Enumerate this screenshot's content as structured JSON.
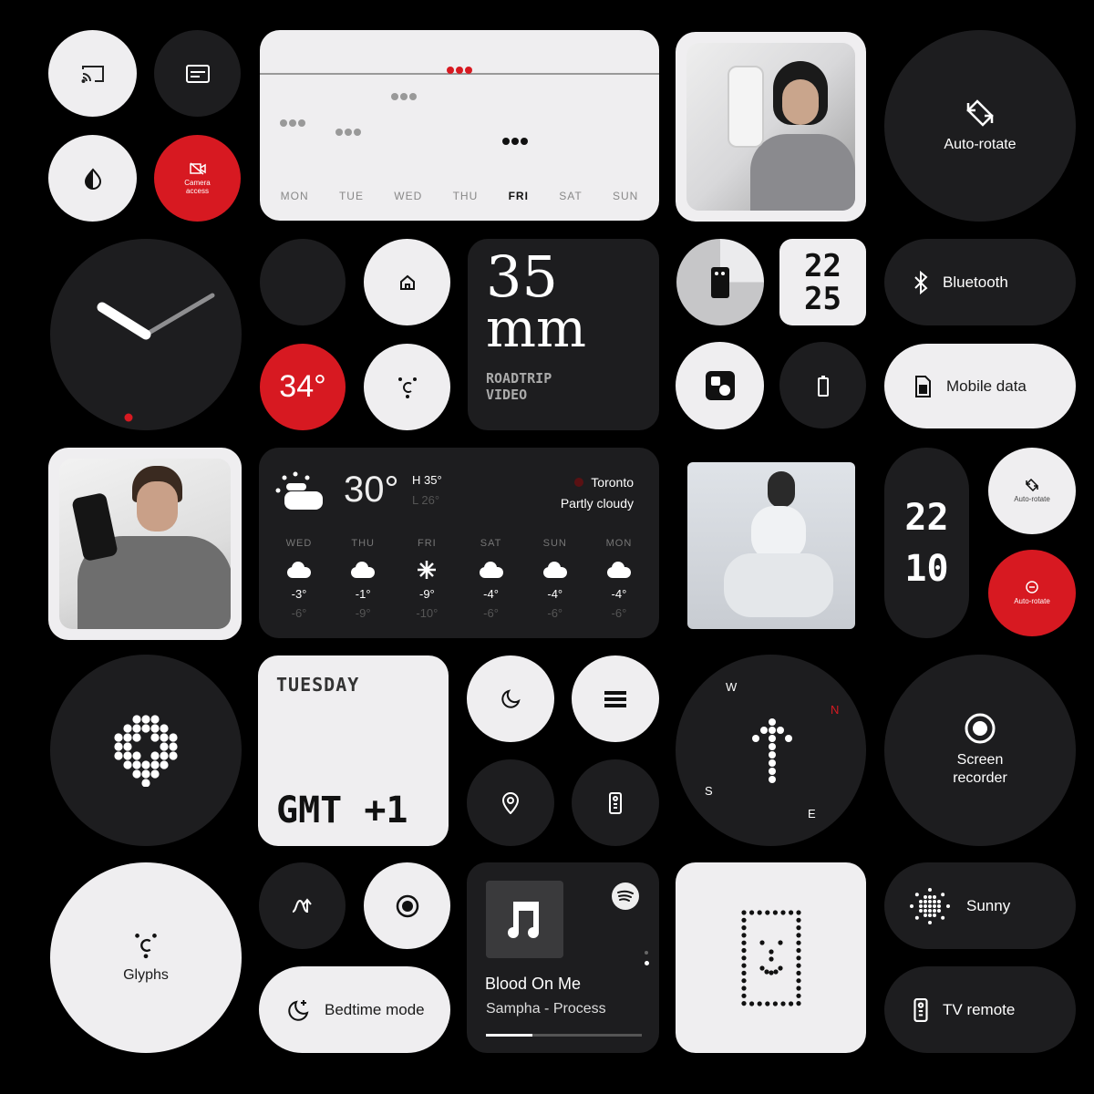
{
  "colors": {
    "background": "#000000",
    "dark_tile": "#1d1d1f",
    "light_tile": "#efeef0",
    "accent_red": "#d71921"
  },
  "quick_tiles": {
    "cast": {
      "icon": "cast-icon"
    },
    "cards": {
      "icon": "cards-icon"
    },
    "dark_theme": {
      "icon": "contrast-drop-icon"
    },
    "camera_access": {
      "label": "Camera access",
      "icon": "camera-off-icon",
      "state": "off"
    },
    "auto_rotate_large": {
      "label": "Auto-rotate",
      "icon": "rotate-icon"
    },
    "home": {
      "icon": "home-icon"
    },
    "temperature": {
      "value": "34°"
    },
    "glyph_small": {
      "icon": "glyph-icon"
    },
    "battery": {
      "icon": "battery-icon"
    },
    "bluetooth": {
      "label": "Bluetooth",
      "icon": "bluetooth-icon"
    },
    "mobile_data": {
      "label": "Mobile data",
      "icon": "sim-icon"
    },
    "auto_rotate_small": {
      "label": "Auto-rotate"
    },
    "auto_rotate_off": {
      "label": "Auto-rotate"
    },
    "dnd": {
      "icon": "moon-icon"
    },
    "list": {
      "icon": "list-icon"
    },
    "location": {
      "icon": "location-icon"
    },
    "remote": {
      "icon": "remote-icon"
    },
    "screen_recorder": {
      "label": "Screen recorder"
    },
    "glyphs": {
      "label": "Glyphs"
    },
    "swap": {
      "icon": "swap-icon"
    },
    "record": {
      "icon": "record-icon"
    },
    "bedtime": {
      "label": "Bedtime mode"
    },
    "sunny": {
      "label": "Sunny"
    },
    "tv_remote": {
      "label": "TV remote"
    }
  },
  "week_widget": {
    "days": [
      "MON",
      "TUE",
      "WED",
      "THU",
      "FRI",
      "SAT",
      "SUN"
    ],
    "today": "FRI",
    "highlight": "THU"
  },
  "camera_widget": {
    "focal": "35",
    "unit": "mm",
    "line1": "ROADTRIP",
    "line2": "VIDEO"
  },
  "clock_tile": {
    "hour": "22",
    "minute": "25"
  },
  "clock_pill": {
    "hour": "22",
    "minute": "10"
  },
  "weather": {
    "temp": "30°",
    "high": "H 35°",
    "low": "L 26°",
    "city": "Toronto",
    "condition": "Partly cloudy",
    "forecast": [
      {
        "day": "WED",
        "high": "-3°",
        "low": "-6°",
        "icon": "cloud"
      },
      {
        "day": "THU",
        "high": "-1°",
        "low": "-9°",
        "icon": "cloud"
      },
      {
        "day": "FRI",
        "high": "-9°",
        "low": "-10°",
        "icon": "snow"
      },
      {
        "day": "SAT",
        "high": "-4°",
        "low": "-6°",
        "icon": "cloud"
      },
      {
        "day": "SUN",
        "high": "-4°",
        "low": "-6°",
        "icon": "cloud"
      },
      {
        "day": "MON",
        "high": "-4°",
        "low": "-6°",
        "icon": "cloud"
      }
    ]
  },
  "world_clock": {
    "day": "TUESDAY",
    "zone": "GMT +1"
  },
  "compass": {
    "n": "N",
    "e": "E",
    "s": "S",
    "w": "W"
  },
  "music": {
    "title": "Blood On Me",
    "subtitle": "Sampha - Process",
    "progress": 0.3,
    "app_icon": "spotify-icon"
  }
}
